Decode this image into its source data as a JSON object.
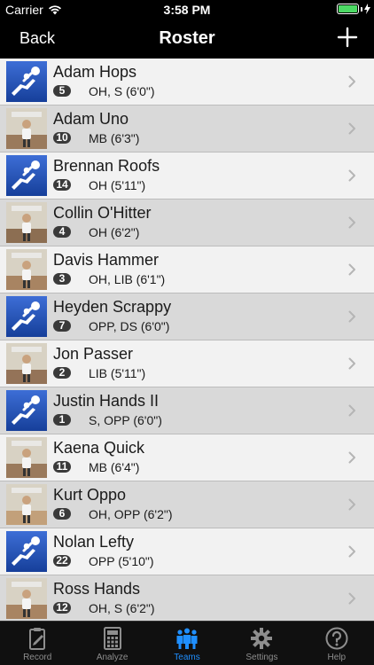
{
  "status": {
    "carrier": "Carrier",
    "time": "3:58 PM"
  },
  "nav": {
    "back_label": "Back",
    "title": "Roster"
  },
  "players": [
    {
      "name": "Adam Hops",
      "number": "5",
      "detail": "OH, S  (6'0\")",
      "photo": "volleyball-logo-icon"
    },
    {
      "name": "Adam Uno",
      "number": "10",
      "detail": "MB  (6'3\")",
      "photo": "player-photo-icon"
    },
    {
      "name": "Brennan Roofs",
      "number": "14",
      "detail": "OH  (5'11\")",
      "photo": "volleyball-logo-icon"
    },
    {
      "name": "Collin O'Hitter",
      "number": "4",
      "detail": "OH  (6'2\")",
      "photo": "player-photo-icon"
    },
    {
      "name": "Davis Hammer",
      "number": "3",
      "detail": "OH, LIB  (6'1\")",
      "photo": "player-photo-icon"
    },
    {
      "name": "Heyden Scrappy",
      "number": "7",
      "detail": "OPP, DS  (6'0\")",
      "photo": "volleyball-logo-icon"
    },
    {
      "name": "Jon Passer",
      "number": "2",
      "detail": "LIB  (5'11\")",
      "photo": "player-photo-icon"
    },
    {
      "name": "Justin Hands II",
      "number": "1",
      "detail": "S, OPP  (6'0\")",
      "photo": "volleyball-logo-icon"
    },
    {
      "name": "Kaena Quick",
      "number": "11",
      "detail": "MB  (6'4\")",
      "photo": "player-photo-icon"
    },
    {
      "name": "Kurt Oppo",
      "number": "6",
      "detail": "OH, OPP  (6'2\")",
      "photo": "player-photo-icon"
    },
    {
      "name": "Nolan Lefty",
      "number": "22",
      "detail": "OPP  (5'10\")",
      "photo": "volleyball-logo-icon"
    },
    {
      "name": "Ross Hands",
      "number": "12",
      "detail": "OH, S  (6'2\")",
      "photo": "player-photo-icon"
    }
  ],
  "tabs": [
    {
      "label": "Record",
      "icon": "clipboard-icon",
      "active": false
    },
    {
      "label": "Analyze",
      "icon": "calculator-icon",
      "active": false
    },
    {
      "label": "Teams",
      "icon": "team-icon",
      "active": true
    },
    {
      "label": "Settings",
      "icon": "gear-icon",
      "active": false
    },
    {
      "label": "Help",
      "icon": "help-icon",
      "active": false
    }
  ],
  "colors": {
    "accent": "#1f8fff",
    "logo_blue": "#1e4fb4",
    "battery": "#4cd964"
  }
}
